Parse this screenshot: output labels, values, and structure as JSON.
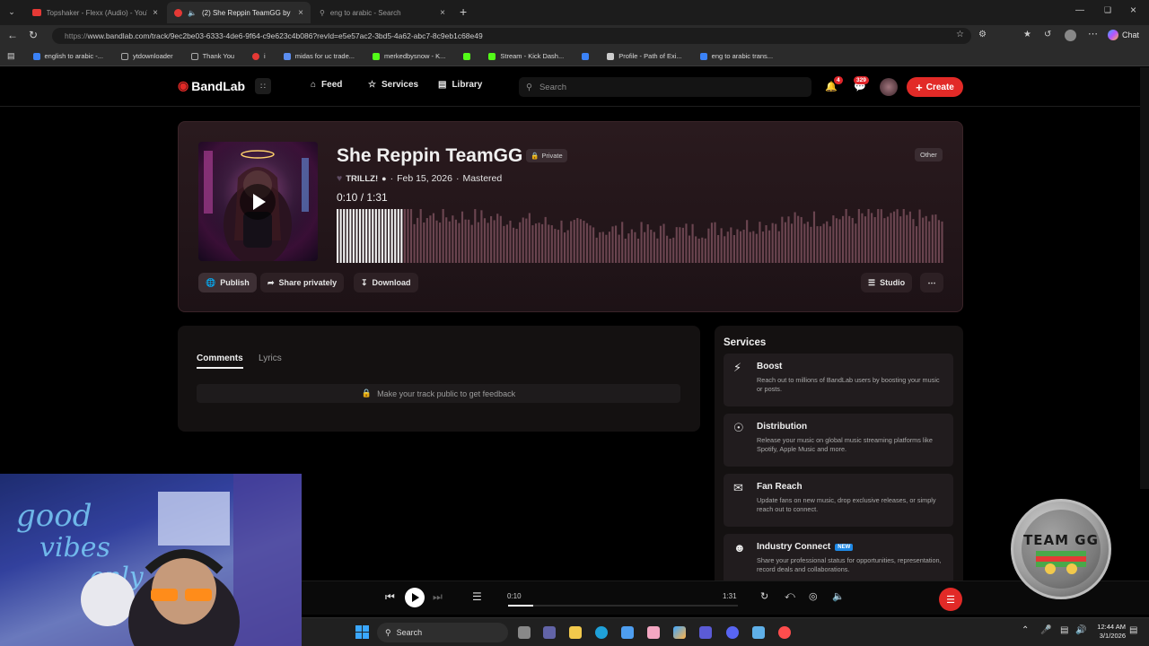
{
  "browser": {
    "tabs": [
      {
        "label": "Topshaker - Flexx (Audio) - YouTu",
        "active": false
      },
      {
        "label": "(2) She Reppin TeamGG by",
        "active": true
      },
      {
        "label": "eng to arabic - Search",
        "active": false
      }
    ],
    "url_scheme": "https://",
    "url_rest": "www.bandlab.com/track/9ec2be03-6333-4de6-9f64-c9e623c4b086?revId=e5e57ac2-3bd5-4a62-abc7-8c9eb1c68e49",
    "chat_label": "Chat",
    "bookmarks": [
      {
        "label": "english to arabic -...",
        "color": "#3b82f6"
      },
      {
        "label": "ytdownloader",
        "color": "#9e9e9e"
      },
      {
        "label": "Thank You",
        "color": "#9e9e9e"
      },
      {
        "label": "i",
        "color": "#e53935"
      },
      {
        "label": "midas for uc trade...",
        "color": "#5b8def"
      },
      {
        "label": "merkedbysnow - K...",
        "color": "#53fc18"
      },
      {
        "label": "",
        "color": "#53fc18"
      },
      {
        "label": "Stream - Kick Dash...",
        "color": "#53fc18"
      },
      {
        "label": "",
        "color": "#3b82f6"
      },
      {
        "label": "Profile - Path of Exi...",
        "color": "#cccccc"
      },
      {
        "label": "eng to arabic trans...",
        "color": "#3b82f6"
      }
    ]
  },
  "site": {
    "brand": "BandLab",
    "nav": {
      "feed": "Feed",
      "services": "Services",
      "library": "Library"
    },
    "search_placeholder": "Search",
    "notifications_count": "4",
    "messages_count": "329",
    "create_label": "Create",
    "brand_color": "#e22a27"
  },
  "track": {
    "title": "She Reppin TeamGG",
    "private_label": "Private",
    "genre_label": "Other",
    "artist": "TRILLZ!",
    "date": "Feb 15, 2026",
    "status": "Mastered",
    "current_time": "0:10",
    "total_time": "1:31",
    "progress": 0.11,
    "actions": {
      "publish": "Publish",
      "share": "Share privately",
      "download": "Download",
      "studio": "Studio"
    }
  },
  "comments": {
    "tab_comments": "Comments",
    "tab_lyrics": "Lyrics",
    "feedback_msg": "Make your track public to get feedback"
  },
  "services": {
    "heading": "Services",
    "items": [
      {
        "name": "Boost",
        "icon": "lightning-icon",
        "desc": "Reach out to millions of BandLab users by boosting your music or posts.",
        "new": ""
      },
      {
        "name": "Distribution",
        "icon": "globe-icon",
        "desc": "Release your music on global music streaming platforms like Spotify, Apple Music and more.",
        "new": ""
      },
      {
        "name": "Fan Reach",
        "icon": "envelope-icon",
        "desc": "Update fans on new music, drop exclusive releases, or simply reach out to connect.",
        "new": ""
      },
      {
        "name": "Industry Connect",
        "icon": "people-icon",
        "desc": "Share your professional status for opportunities, representation, record deals and collaborations.",
        "new": "NEW"
      }
    ]
  },
  "player": {
    "current": "0:10",
    "total": "1:31",
    "progress": 0.11
  },
  "overlay_logo": "TEAM GG",
  "taskbar": {
    "search_label": "Search",
    "time": "12:44 AM",
    "date": "3/1/2026"
  }
}
